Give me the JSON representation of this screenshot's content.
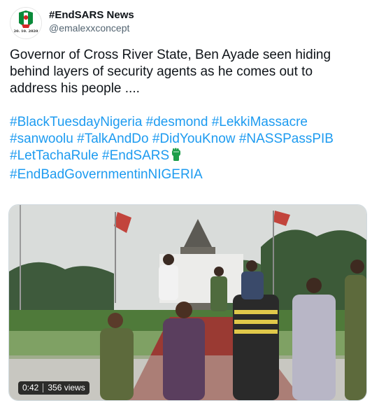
{
  "author": {
    "display_name": "#EndSARS News",
    "handle": "@emalexxconcept",
    "avatar_caption": "20. 10. 2020"
  },
  "tweet": {
    "text": "Governor of Cross River State, Ben Ayade seen hiding behind layers of security agents as he comes out to address his people ....",
    "hashtags_line1": [
      "#BlackTuesdayNigeria",
      "#desmond",
      "#LekkiMassacre"
    ],
    "hashtags_line2": [
      "#sanwoolu",
      "#TalkAndDo",
      "#DidYouKnow",
      "#NASSPassPIB"
    ],
    "hashtags_line3": [
      "#LetTachaRule",
      "#EndSARS"
    ],
    "hashtags_line4": [
      "#EndBadGovernmentinNIGERIA"
    ]
  },
  "media": {
    "type": "video",
    "duration": "0:42",
    "views": "356 views"
  },
  "colors": {
    "link": "#1d9bf0",
    "text": "#0f1419",
    "secondary": "#536471"
  }
}
